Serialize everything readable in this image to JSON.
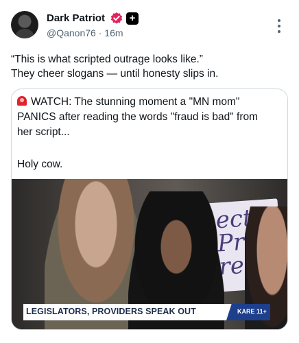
{
  "author": {
    "display_name": "Dark Patriot",
    "handle": "@Qanon76",
    "separator": "·",
    "time": "16m",
    "avatar_icon": "anonymous-mask-avatar",
    "verified_icon": "verified-badge-icon",
    "subscriber_icon": "plus-badge-icon",
    "verified_color": "#e0245e"
  },
  "post": {
    "lines": [
      "“This is what scripted outrage looks like.”",
      "They cheer slogans — until honesty slips in."
    ]
  },
  "quote": {
    "siren_icon": "siren-emoji",
    "lines": [
      "WATCH: The stunning moment a \"MN mom\"",
      "PANICS after reading the words \"fraud is bad\" from",
      "her script..."
    ],
    "comment": "Holy cow.",
    "media": {
      "caption_banner": "LEGISLATORS, PROVIDERS SPEAK OUT",
      "station_logo": "KARE 11+",
      "sign_text": "ect Pro ren"
    }
  },
  "more_icon": "more-options-icon"
}
